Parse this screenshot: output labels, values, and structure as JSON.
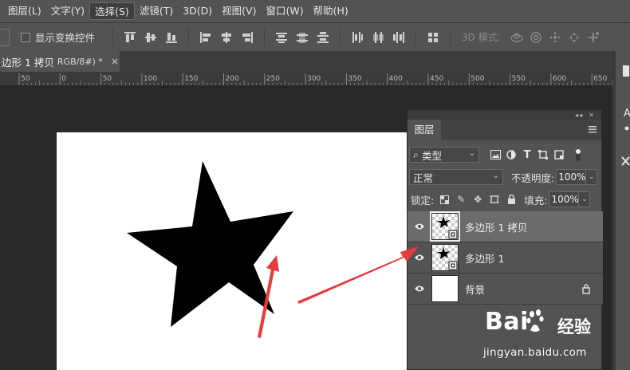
{
  "menu": {
    "items": [
      {
        "label": "图层(L)",
        "active": false
      },
      {
        "label": "文字(Y)",
        "active": false
      },
      {
        "label": "选择(S)",
        "active": true
      },
      {
        "label": "滤镜(T)",
        "active": false
      },
      {
        "label": "3D(D)",
        "active": false
      },
      {
        "label": "视图(V)",
        "active": false
      },
      {
        "label": "窗口(W)",
        "active": false
      },
      {
        "label": "帮助(H)",
        "active": false
      }
    ]
  },
  "options_bar": {
    "show_transform_controls_label": "显示变换控件",
    "show_transform_controls_checked": false,
    "mode_3d_label": "3D 模式:"
  },
  "document": {
    "tab_title": "边形 1 拷贝",
    "tab_mode": "RGB/8#) *",
    "close_glyph": "×",
    "background_color": "#ffffff"
  },
  "ruler": {
    "ticks": [
      "50",
      "0",
      "50",
      "100",
      "150",
      "200",
      "250",
      "300",
      "350",
      "400",
      "450",
      "500",
      "550",
      "600",
      "650"
    ]
  },
  "layers_panel": {
    "tab_label": "图层",
    "filter_label": "类型",
    "blend_mode": "正常",
    "opacity_label": "不透明度:",
    "opacity_value": "100%",
    "lock_label": "锁定:",
    "fill_label": "填充:",
    "fill_value": "100%",
    "layers": [
      {
        "name": "多边形 1 拷贝",
        "selected": true,
        "thumb": "star",
        "visible": true,
        "locked": false
      },
      {
        "name": "多边形 1",
        "selected": false,
        "thumb": "star",
        "visible": true,
        "locked": false
      },
      {
        "name": "背景",
        "selected": false,
        "thumb": "white",
        "visible": true,
        "locked": true
      }
    ]
  },
  "annotations": {
    "arrow_color": "#e83a3a"
  },
  "watermark": {
    "brand": "Bai",
    "brand_tail": "经验",
    "url": "jingyan.baidu.com"
  }
}
